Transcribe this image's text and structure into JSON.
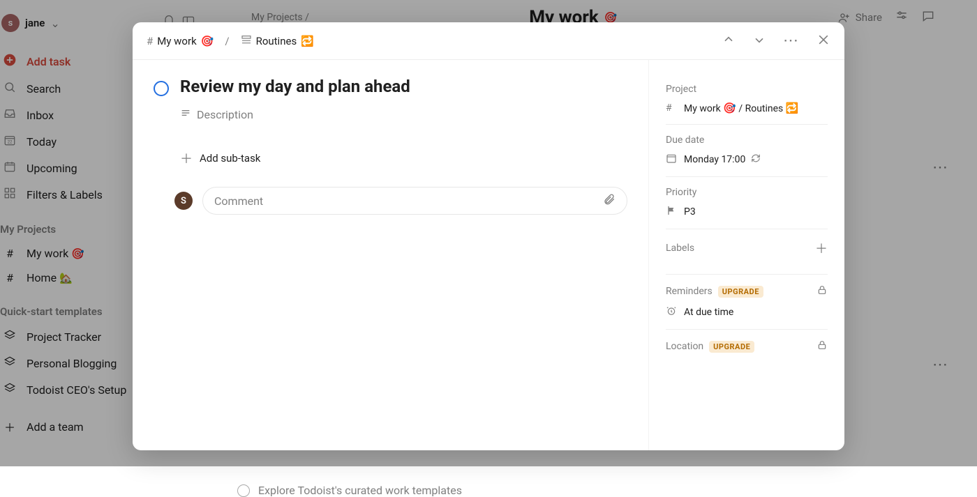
{
  "user": {
    "initial": "s",
    "name": "jane"
  },
  "sidebar": {
    "add_task": "Add task",
    "nav": [
      {
        "icon": "search",
        "label": "Search"
      },
      {
        "icon": "inbox",
        "label": "Inbox"
      },
      {
        "icon": "today",
        "label": "Today"
      },
      {
        "icon": "upcoming",
        "label": "Upcoming"
      },
      {
        "icon": "filters",
        "label": "Filters & Labels"
      }
    ],
    "projects_heading": "My Projects",
    "projects": [
      {
        "label": "My work",
        "emoji": "🎯"
      },
      {
        "label": "Home",
        "emoji": "🏡"
      }
    ],
    "templates_heading": "Quick-start templates",
    "templates": [
      {
        "label": "Project Tracker"
      },
      {
        "label": "Personal Blogging"
      },
      {
        "label": "Todoist CEO's Setup"
      }
    ],
    "add_team": "Add a team"
  },
  "background": {
    "breadcrumb": "My Projects /",
    "title": "My work",
    "title_emoji": "🎯",
    "share": "Share",
    "bottom_task": "Explore Todoist's curated work templates"
  },
  "modal": {
    "crumb1": {
      "label": "My work",
      "emoji": "🎯"
    },
    "crumb2": {
      "label": "Routines",
      "emoji": "🔁"
    },
    "task_title": "Review my day and plan ahead",
    "description_placeholder": "Description",
    "add_subtask": "Add sub-task",
    "comment_placeholder": "Comment",
    "avatar_initial": "S",
    "side": {
      "project": {
        "label": "Project",
        "project": "My work",
        "project_emoji": "🎯",
        "section": "Routines",
        "section_emoji": "🔁"
      },
      "due": {
        "label": "Due date",
        "value": "Monday 17:00"
      },
      "priority": {
        "label": "Priority",
        "value": "P3"
      },
      "labels": {
        "label": "Labels"
      },
      "reminders": {
        "label": "Reminders",
        "badge": "UPGRADE",
        "value": "At due time"
      },
      "location": {
        "label": "Location",
        "badge": "UPGRADE"
      }
    }
  }
}
